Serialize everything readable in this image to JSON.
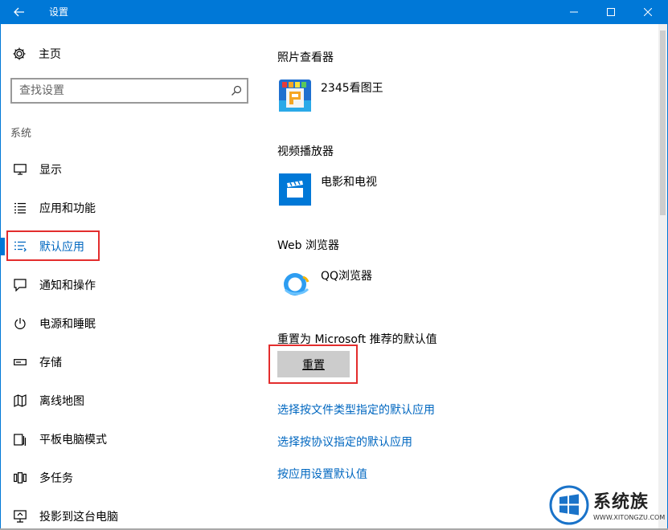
{
  "window": {
    "title": "设置",
    "back_icon": "back-arrow-icon",
    "controls": [
      "minimize-icon",
      "maximize-icon",
      "close-icon"
    ],
    "accent_color": "#0078d7"
  },
  "sidebar": {
    "home_label": "主页",
    "search_placeholder": "查找设置",
    "group_label": "系统",
    "items": [
      {
        "label": "显示",
        "icon": "monitor-icon"
      },
      {
        "label": "应用和功能",
        "icon": "app-list-icon"
      },
      {
        "label": "默认应用",
        "icon": "default-apps-icon",
        "active": true
      },
      {
        "label": "通知和操作",
        "icon": "notification-icon"
      },
      {
        "label": "电源和睡眠",
        "icon": "power-icon"
      },
      {
        "label": "存储",
        "icon": "storage-icon"
      },
      {
        "label": "离线地图",
        "icon": "map-icon"
      },
      {
        "label": "平板电脑模式",
        "icon": "tablet-icon"
      },
      {
        "label": "多任务",
        "icon": "multitask-icon"
      },
      {
        "label": "投影到这台电脑",
        "icon": "project-icon"
      }
    ]
  },
  "main": {
    "photo_viewer": {
      "title": "照片查看器",
      "app": "2345看图王",
      "icon": "2345-viewer-icon"
    },
    "video_player": {
      "title": "视频播放器",
      "app": "电影和电视",
      "icon": "movies-tv-icon"
    },
    "web_browser": {
      "title": "Web 浏览器",
      "app": "QQ浏览器",
      "icon": "qq-browser-icon"
    },
    "reset": {
      "title": "重置为 Microsoft 推荐的默认值",
      "button": "重置"
    },
    "links": [
      "选择按文件类型指定的默认应用",
      "选择按协议指定的默认应用",
      "按应用设置默认值"
    ]
  },
  "watermark": {
    "text": "系统族",
    "url": "WWW.XITONGZU.COM"
  }
}
